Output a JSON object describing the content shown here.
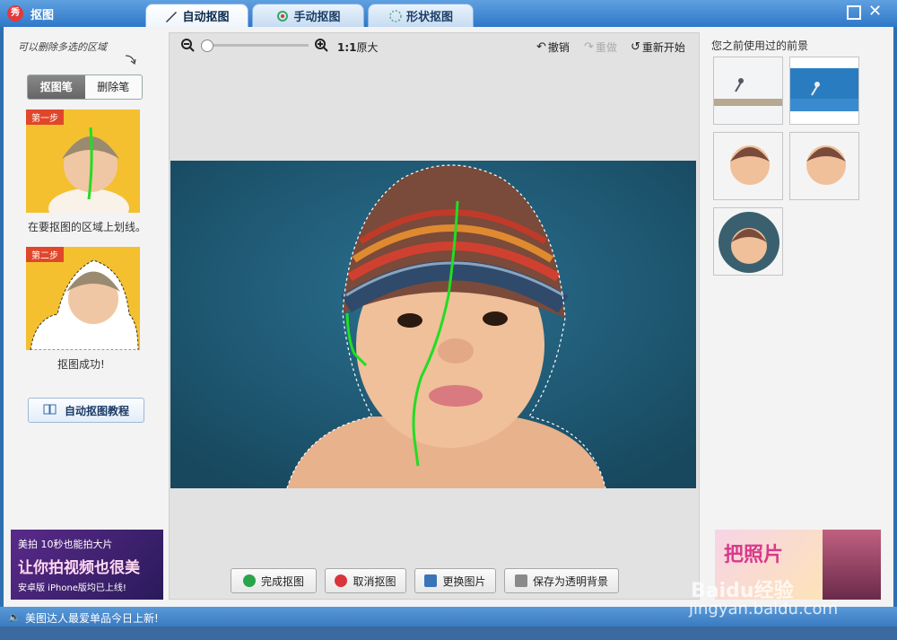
{
  "window": {
    "title": "抠图",
    "app_icon_text": "秀"
  },
  "tabs": [
    {
      "label": "自动抠图",
      "active": true
    },
    {
      "label": "手动抠图",
      "active": false
    },
    {
      "label": "形状抠图",
      "active": false
    }
  ],
  "left_panel": {
    "hint": "可以删除多选的区域",
    "pen_cut_label": "抠图笔",
    "pen_erase_label": "删除笔",
    "step1": {
      "tag": "第一步",
      "caption": "在要抠图的区域上划线。"
    },
    "step2": {
      "tag": "第二步",
      "caption": "抠图成功!"
    },
    "tutorial_button": "自动抠图教程",
    "ad": {
      "line1": "美拍 10秒也能拍大片",
      "line2": "让你拍视频也很美",
      "line3": "安卓版  iPhone版均已上线!"
    }
  },
  "toolbar": {
    "zoom_ratio": "1:1",
    "original_size_label": "原大",
    "undo_label": "撤销",
    "redo_label": "重做",
    "restart_label": "重新开始"
  },
  "bottom_buttons": {
    "finish": "完成抠图",
    "cancel": "取消抠图",
    "replace": "更换图片",
    "save_transparent": "保存为透明背景"
  },
  "right_panel": {
    "recent_title": "您之前使用过的前景",
    "ad_text": "把照片"
  },
  "statusbar": {
    "text": "美图达人最爱单品今日上新!"
  },
  "watermark": {
    "brand": "Baidu经验",
    "url": "jingyan.baidu.com"
  },
  "colors": {
    "titlebar": "#2f78c8",
    "accent_red": "#e0462a",
    "canvas_bg": "#1f5e7a",
    "selection_green": "#22dd22"
  }
}
